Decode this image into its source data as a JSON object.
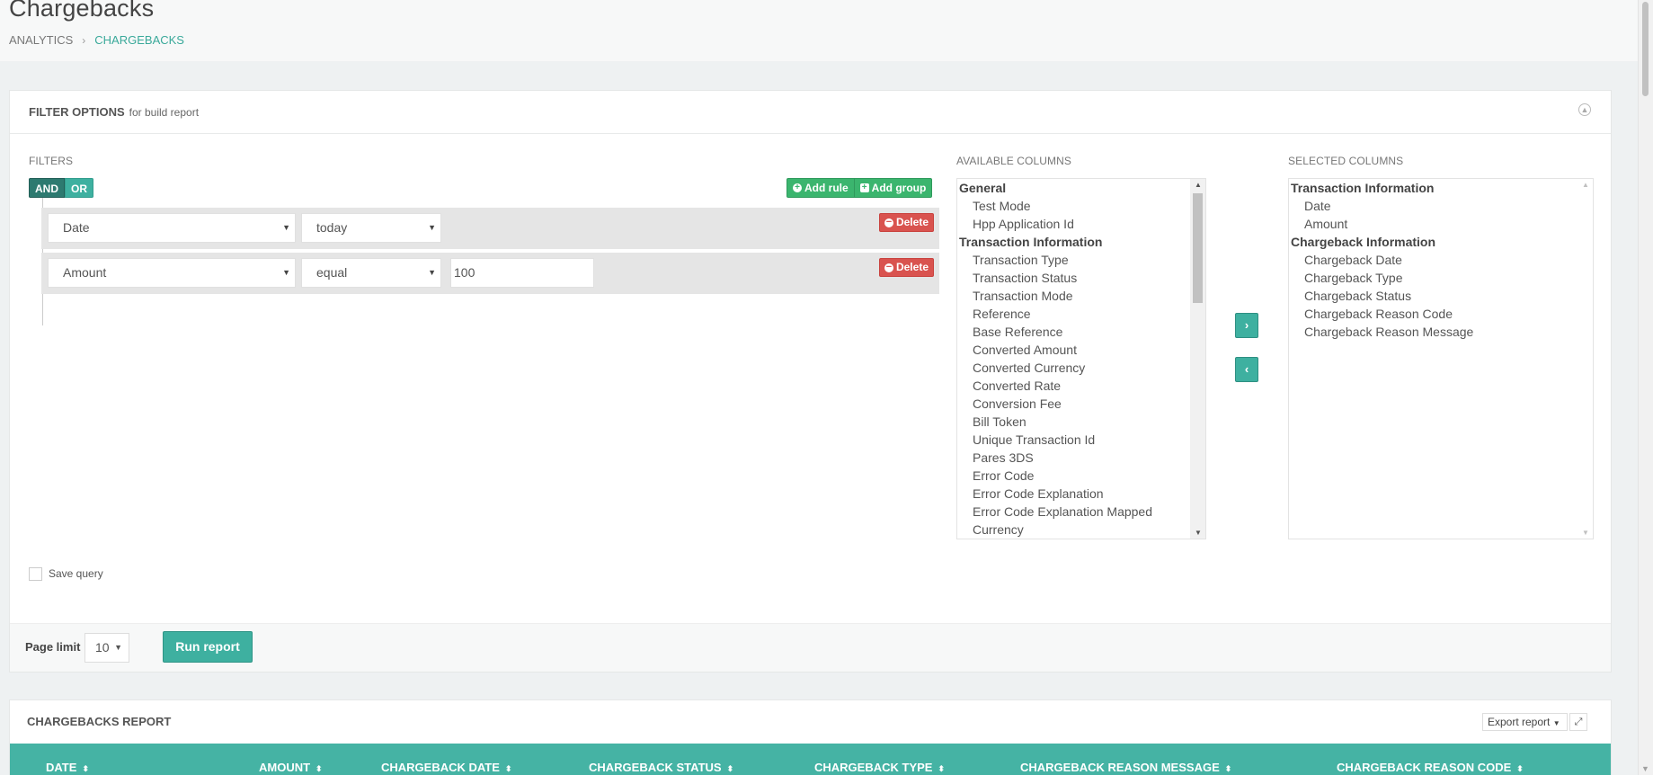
{
  "header": {
    "title": "Chargebacks",
    "breadcrumb": [
      "ANALYTICS",
      "CHARGEBACKS"
    ]
  },
  "filter_panel": {
    "title": "FILTER OPTIONS",
    "subtitle": "for build report",
    "filters_label": "FILTERS",
    "and_label": "AND",
    "or_label": "OR",
    "add_rule_label": "Add rule",
    "add_group_label": "Add group",
    "rules": [
      {
        "field": "Date",
        "operator": "today",
        "value": "",
        "delete_label": "Delete"
      },
      {
        "field": "Amount",
        "operator": "equal",
        "value": "100",
        "delete_label": "Delete"
      }
    ],
    "available_columns_label": "AVAILABLE COLUMNS",
    "available_columns": [
      {
        "type": "group",
        "label": "General"
      },
      {
        "type": "item",
        "label": "Test Mode"
      },
      {
        "type": "item",
        "label": "Hpp Application Id"
      },
      {
        "type": "group",
        "label": "Transaction Information"
      },
      {
        "type": "item",
        "label": "Transaction Type"
      },
      {
        "type": "item",
        "label": "Transaction Status"
      },
      {
        "type": "item",
        "label": "Transaction Mode"
      },
      {
        "type": "item",
        "label": "Reference"
      },
      {
        "type": "item",
        "label": "Base Reference"
      },
      {
        "type": "item",
        "label": "Converted Amount"
      },
      {
        "type": "item",
        "label": "Converted Currency"
      },
      {
        "type": "item",
        "label": "Converted Rate"
      },
      {
        "type": "item",
        "label": "Conversion Fee"
      },
      {
        "type": "item",
        "label": "Bill Token"
      },
      {
        "type": "item",
        "label": "Unique Transaction Id"
      },
      {
        "type": "item",
        "label": "Pares 3DS"
      },
      {
        "type": "item",
        "label": "Error Code"
      },
      {
        "type": "item",
        "label": "Error Code Explanation"
      },
      {
        "type": "item",
        "label": "Error Code Explanation Mapped"
      },
      {
        "type": "item",
        "label": "Currency"
      }
    ],
    "selected_columns_label": "SELECTED COLUMNS",
    "selected_columns": [
      {
        "type": "group",
        "label": "Transaction Information"
      },
      {
        "type": "item",
        "label": "Date"
      },
      {
        "type": "item",
        "label": "Amount"
      },
      {
        "type": "group",
        "label": "Chargeback Information"
      },
      {
        "type": "item",
        "label": "Chargeback Date"
      },
      {
        "type": "item",
        "label": "Chargeback Type"
      },
      {
        "type": "item",
        "label": "Chargeback Status"
      },
      {
        "type": "item",
        "label": "Chargeback Reason Code"
      },
      {
        "type": "item",
        "label": "Chargeback Reason Message"
      }
    ],
    "move_right_label": "›",
    "move_left_label": "‹",
    "save_query_label": "Save query",
    "page_limit_label": "Page limit",
    "page_limit_value": "10",
    "run_report_label": "Run report"
  },
  "report_panel": {
    "title": "CHARGEBACKS REPORT",
    "export_label": "Export report",
    "columns": [
      "DATE",
      "AMOUNT",
      "CHARGEBACK DATE",
      "CHARGEBACK STATUS",
      "CHARGEBACK TYPE",
      "CHARGEBACK REASON MESSAGE",
      "CHARGEBACK REASON CODE"
    ]
  },
  "icons": {
    "collapse": "arrow-up-circle-icon",
    "add_rule": "plus-circle-icon",
    "add_group": "plus-square-icon",
    "delete": "minus-circle-icon",
    "sort": "sort-icon",
    "expand": "expand-icon"
  },
  "colors": {
    "accent": "#3eb0a0",
    "and_active": "#2d7a70",
    "add_green": "#3bb56e",
    "delete_red": "#d9534f",
    "table_header": "#45b3a4"
  }
}
